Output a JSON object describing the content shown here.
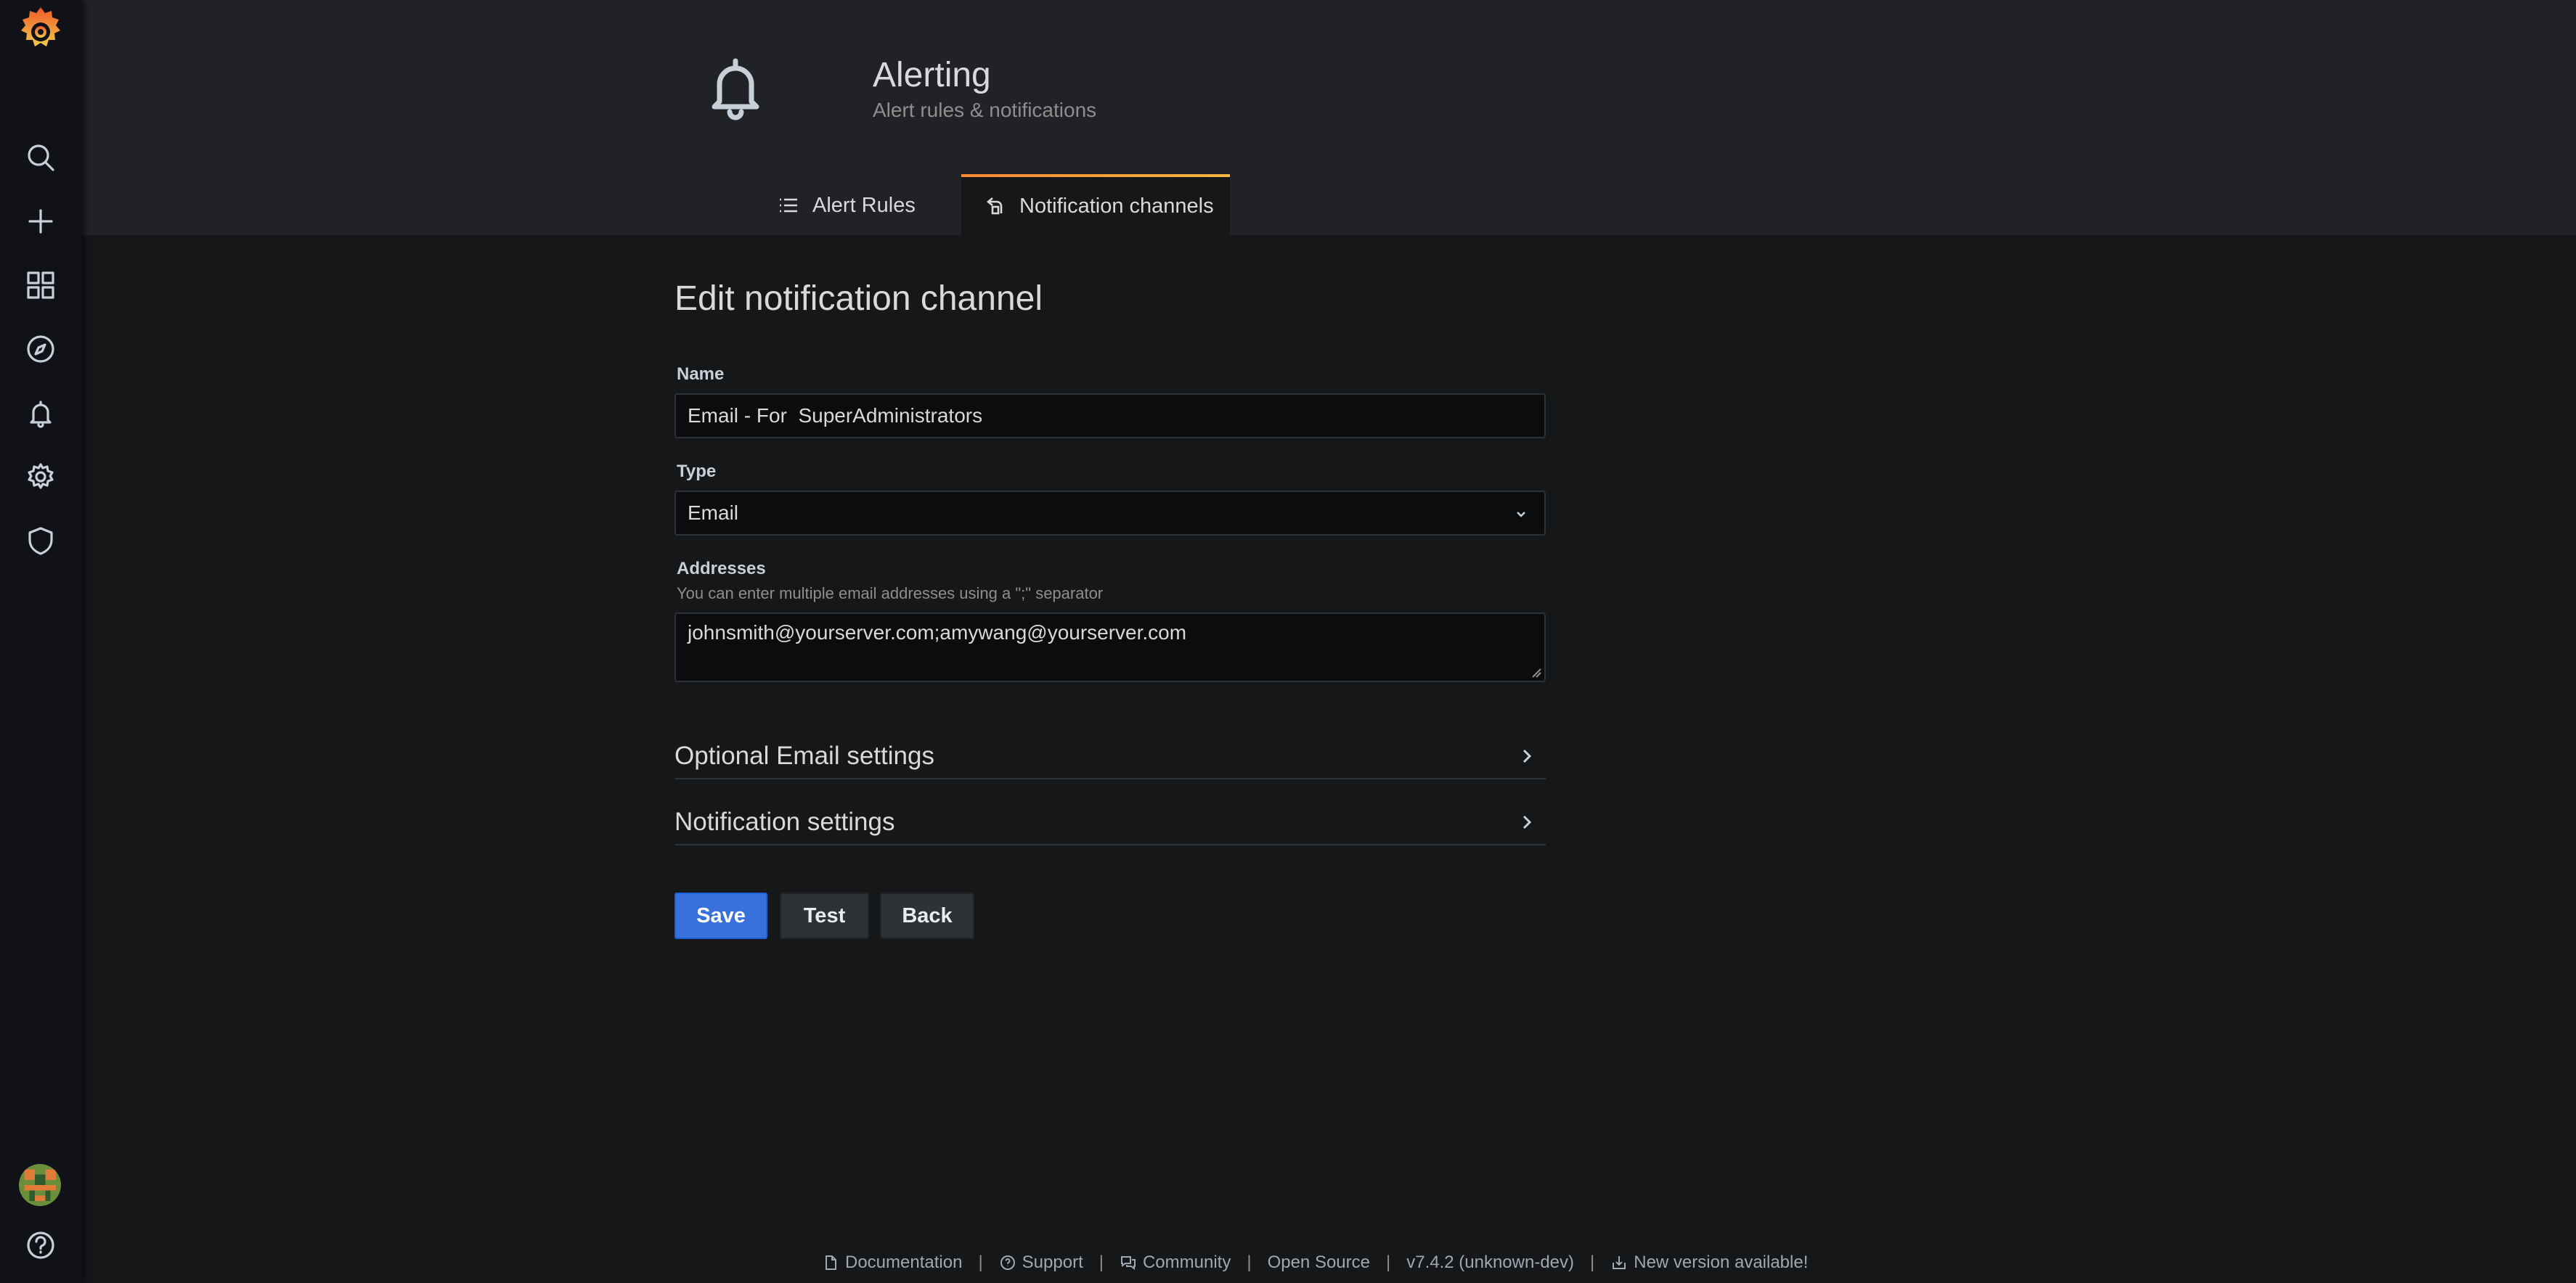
{
  "header": {
    "title": "Alerting",
    "subtitle": "Alert rules & notifications",
    "tabs": [
      {
        "label": "Alert Rules",
        "icon": "list-icon"
      },
      {
        "label": "Notification channels",
        "icon": "notification-channel-icon"
      }
    ]
  },
  "form": {
    "title": "Edit notification channel",
    "name_label": "Name",
    "name_value": "Email - For  SuperAdministrators",
    "type_label": "Type",
    "type_value": "Email",
    "addresses_label": "Addresses",
    "addresses_desc": "You can enter multiple email addresses using a \";\" separator",
    "addresses_value": "johnsmith@yourserver.com;amywang@yourserver.com",
    "sections": [
      "Optional Email settings",
      "Notification settings"
    ],
    "buttons": {
      "save": "Save",
      "test": "Test",
      "back": "Back"
    }
  },
  "footer": {
    "documentation": "Documentation",
    "support": "Support",
    "community": "Community",
    "open_source": "Open Source",
    "version": "v7.4.2 (unknown-dev)",
    "new_version": "New version available!",
    "separator": "|"
  },
  "colors": {
    "primary": "#3871dc",
    "tab_accent": "#ff8833",
    "background": "#161719",
    "sidebar": "#111217"
  }
}
